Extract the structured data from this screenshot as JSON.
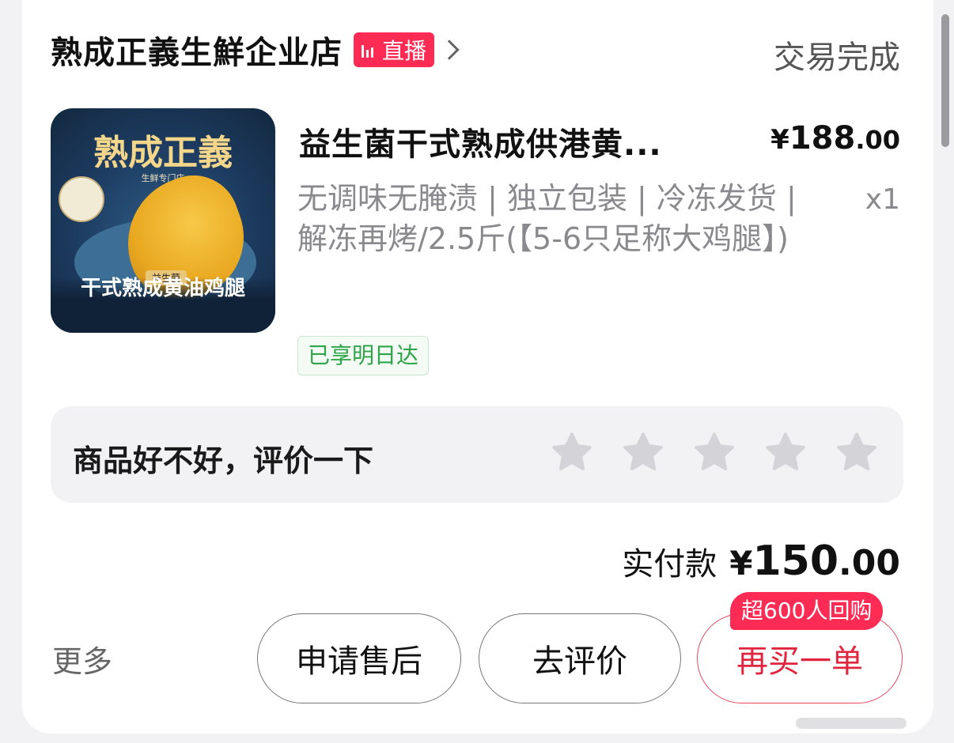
{
  "store": {
    "name": "熟成正義生鮮企业店",
    "live_label": "直播"
  },
  "order": {
    "status": "交易完成"
  },
  "product": {
    "image": {
      "title": "熟成正義",
      "subtitle": "生鲜专门店",
      "caption": "干式熟成黄油鸡腿",
      "tag": "益生菌"
    },
    "title": "益生菌干式熟成供港黄...",
    "price_symbol": "¥",
    "price_integer": "188",
    "price_decimal": ".00",
    "specs": "无调味无腌渍 | 独立包装 | 冷冻发货 | 解冻再烤/2.5斤(【5-6只足称大鸡腿】)",
    "quantity": "x1",
    "delivery_tag": "已享明日达"
  },
  "review": {
    "prompt": "商品好不好，评价一下",
    "rating": 0,
    "max_rating": 5
  },
  "payment": {
    "label": "实付款",
    "symbol": "¥",
    "integer": "150",
    "decimal": ".00"
  },
  "actions": {
    "more": "更多",
    "after_sale": "申请售后",
    "write_review": "去评价",
    "rebuy": "再买一单",
    "rebuy_badge": "超600人回购"
  },
  "colors": {
    "accent": "#fe2c55",
    "rebuy_text": "#e0263f",
    "delivery_green": "#2fa54a",
    "muted_text": "#8a8a8e",
    "star_empty": "#d4d4d8"
  }
}
